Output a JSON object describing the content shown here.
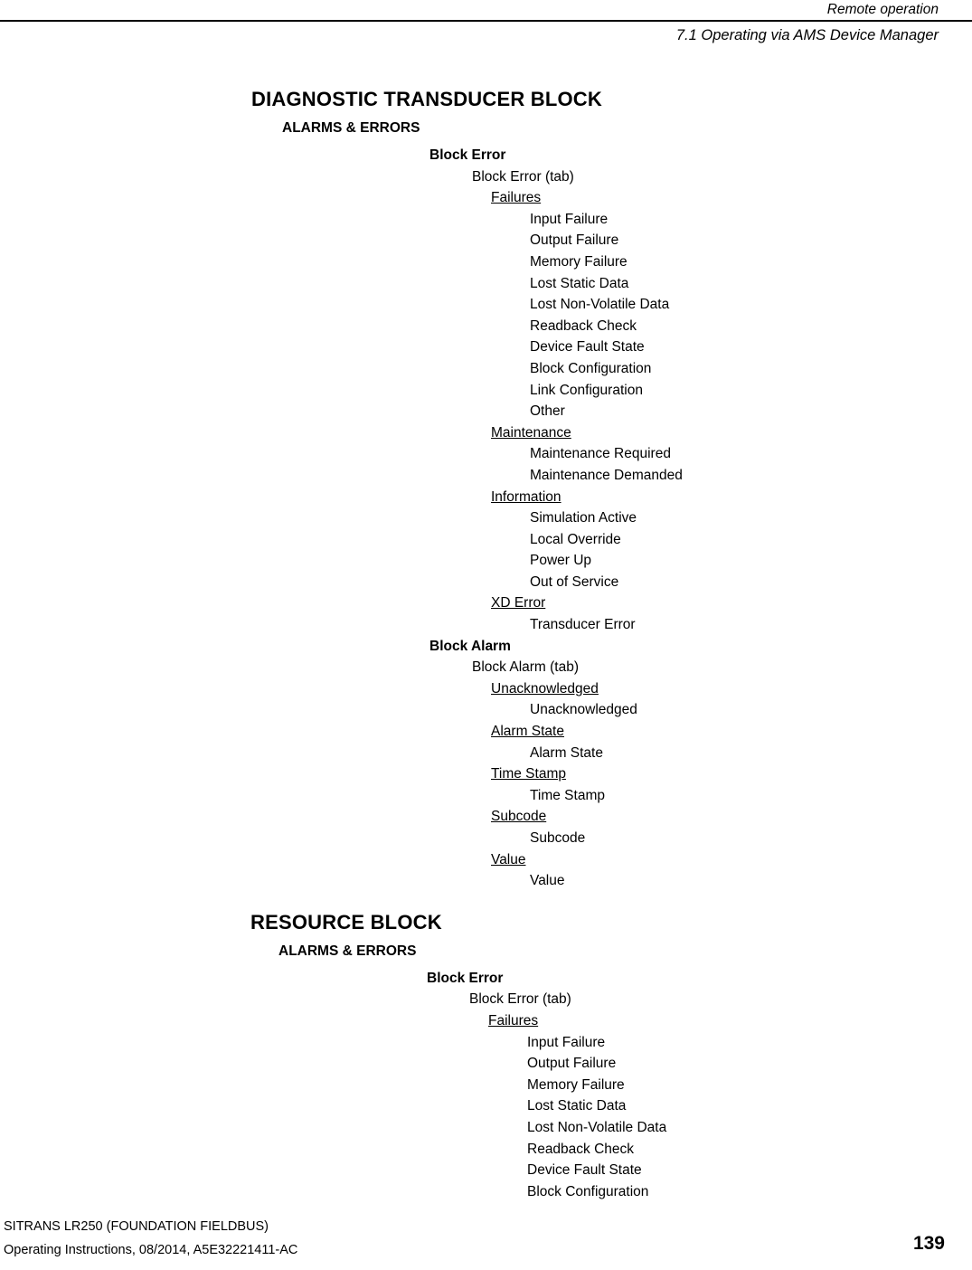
{
  "header": {
    "chapter": "Remote operation",
    "section": "7.1 Operating via AMS Device Manager"
  },
  "footer": {
    "product": "SITRANS LR250 (FOUNDATION FIELDBUS)",
    "document": "Operating Instructions, 08/2014, A5E32221411-AC",
    "page_number": "139"
  },
  "sections": [
    {
      "title": "DIAGNOSTIC TRANSDUCER BLOCK",
      "indent": 278,
      "group": {
        "label": "ALARMS & ERRORS",
        "indent": 312
      },
      "rows": [
        {
          "label": "Block Error",
          "indent": 475,
          "style": "bold"
        },
        {
          "label": "Block Error (tab)",
          "indent": 522,
          "style": "plain"
        },
        {
          "label": "Failures",
          "indent": 543,
          "style": "underline"
        },
        {
          "label": "Input Failure",
          "indent": 586,
          "style": "plain"
        },
        {
          "label": "Output Failure",
          "indent": 586,
          "style": "plain"
        },
        {
          "label": "Memory Failure",
          "indent": 586,
          "style": "plain"
        },
        {
          "label": "Lost Static Data",
          "indent": 586,
          "style": "plain"
        },
        {
          "label": "Lost Non-Volatile Data",
          "indent": 586,
          "style": "plain"
        },
        {
          "label": "Readback Check",
          "indent": 586,
          "style": "plain"
        },
        {
          "label": "Device Fault State",
          "indent": 586,
          "style": "plain"
        },
        {
          "label": "Block Configuration",
          "indent": 586,
          "style": "plain"
        },
        {
          "label": "Link Configuration",
          "indent": 586,
          "style": "plain"
        },
        {
          "label": "Other",
          "indent": 586,
          "style": "plain"
        },
        {
          "label": "Maintenance",
          "indent": 543,
          "style": "underline"
        },
        {
          "label": "Maintenance Required",
          "indent": 586,
          "style": "plain"
        },
        {
          "label": "Maintenance Demanded",
          "indent": 586,
          "style": "plain"
        },
        {
          "label": "Information",
          "indent": 543,
          "style": "underline"
        },
        {
          "label": "Simulation Active",
          "indent": 586,
          "style": "plain"
        },
        {
          "label": "Local Override",
          "indent": 586,
          "style": "plain"
        },
        {
          "label": "Power Up",
          "indent": 586,
          "style": "plain"
        },
        {
          "label": "Out of Service",
          "indent": 586,
          "style": "plain"
        },
        {
          "label": "XD Error",
          "indent": 543,
          "style": "underline"
        },
        {
          "label": "Transducer Error",
          "indent": 586,
          "style": "plain"
        },
        {
          "label": "Block Alarm",
          "indent": 475,
          "style": "bold"
        },
        {
          "label": "Block Alarm (tab)",
          "indent": 522,
          "style": "plain"
        },
        {
          "label": "Unacknowledged",
          "indent": 543,
          "style": "underline"
        },
        {
          "label": "Unacknowledged",
          "indent": 586,
          "style": "plain"
        },
        {
          "label": "Alarm State",
          "indent": 543,
          "style": "underline"
        },
        {
          "label": "Alarm State",
          "indent": 586,
          "style": "plain"
        },
        {
          "label": "Time Stamp",
          "indent": 543,
          "style": "underline"
        },
        {
          "label": "Time Stamp",
          "indent": 586,
          "style": "plain"
        },
        {
          "label": "Subcode",
          "indent": 543,
          "style": "underline"
        },
        {
          "label": "Subcode",
          "indent": 586,
          "style": "plain"
        },
        {
          "label": "Value",
          "indent": 543,
          "style": "underline"
        },
        {
          "label": "Value",
          "indent": 586,
          "style": "plain"
        }
      ]
    },
    {
      "title": "RESOURCE BLOCK",
      "indent": 277,
      "group": {
        "label": "ALARMS & ERRORS",
        "indent": 308
      },
      "rows": [
        {
          "label": "Block Error",
          "indent": 472,
          "style": "bold"
        },
        {
          "label": "Block Error (tab)",
          "indent": 519,
          "style": "plain"
        },
        {
          "label": "Failures",
          "indent": 540,
          "style": "underline"
        },
        {
          "label": "Input Failure",
          "indent": 583,
          "style": "plain"
        },
        {
          "label": "Output Failure",
          "indent": 583,
          "style": "plain"
        },
        {
          "label": "Memory Failure",
          "indent": 583,
          "style": "plain"
        },
        {
          "label": "Lost Static Data",
          "indent": 583,
          "style": "plain"
        },
        {
          "label": "Lost Non-Volatile Data",
          "indent": 583,
          "style": "plain"
        },
        {
          "label": "Readback Check",
          "indent": 583,
          "style": "plain"
        },
        {
          "label": "Device Fault State",
          "indent": 583,
          "style": "plain"
        },
        {
          "label": "Block Configuration",
          "indent": 583,
          "style": "plain"
        }
      ]
    }
  ]
}
